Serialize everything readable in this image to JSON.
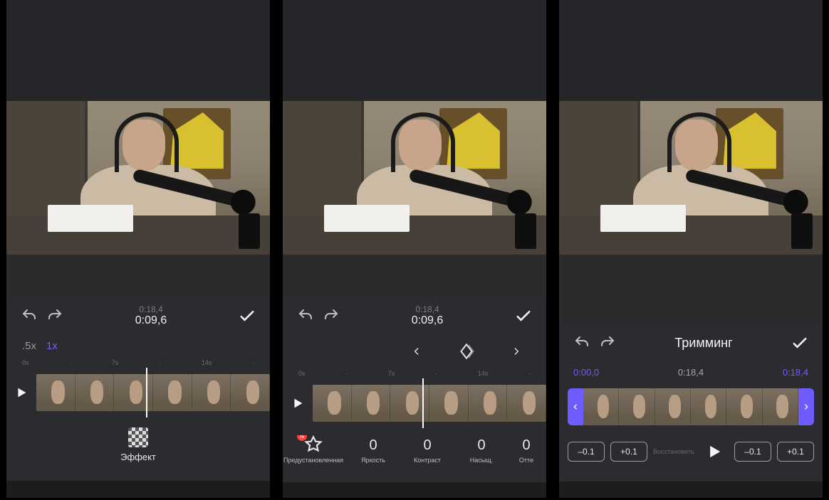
{
  "panel1": {
    "time_total": "0:18,4",
    "time_current": "0:09,6",
    "speeds": {
      "half": ".5x",
      "one": "1x"
    },
    "ticks": {
      "t0": "0s",
      "t1": "7s",
      "t2": "14s"
    },
    "effect_label": "Эффект"
  },
  "panel2": {
    "time_total": "0:18,4",
    "time_current": "0:09,6",
    "ticks": {
      "t0": "0s",
      "t1": "7s",
      "t2": "14s"
    },
    "adjust": {
      "preset": {
        "label": "Предустановленная",
        "badge": "N"
      },
      "brightness": {
        "label": "Яркость",
        "value": "0"
      },
      "contrast": {
        "label": "Контраст",
        "value": "0"
      },
      "saturation": {
        "label": "Насыщ.",
        "value": "0"
      },
      "hue": {
        "label": "Отте",
        "value": "0"
      }
    }
  },
  "panel3": {
    "title": "Тримминг",
    "time_start": "0:00,0",
    "time_mid": "0:18,4",
    "time_end": "0:18,4",
    "minus": "–0.1",
    "plus": "+0.1",
    "restore": "Восстановить"
  }
}
